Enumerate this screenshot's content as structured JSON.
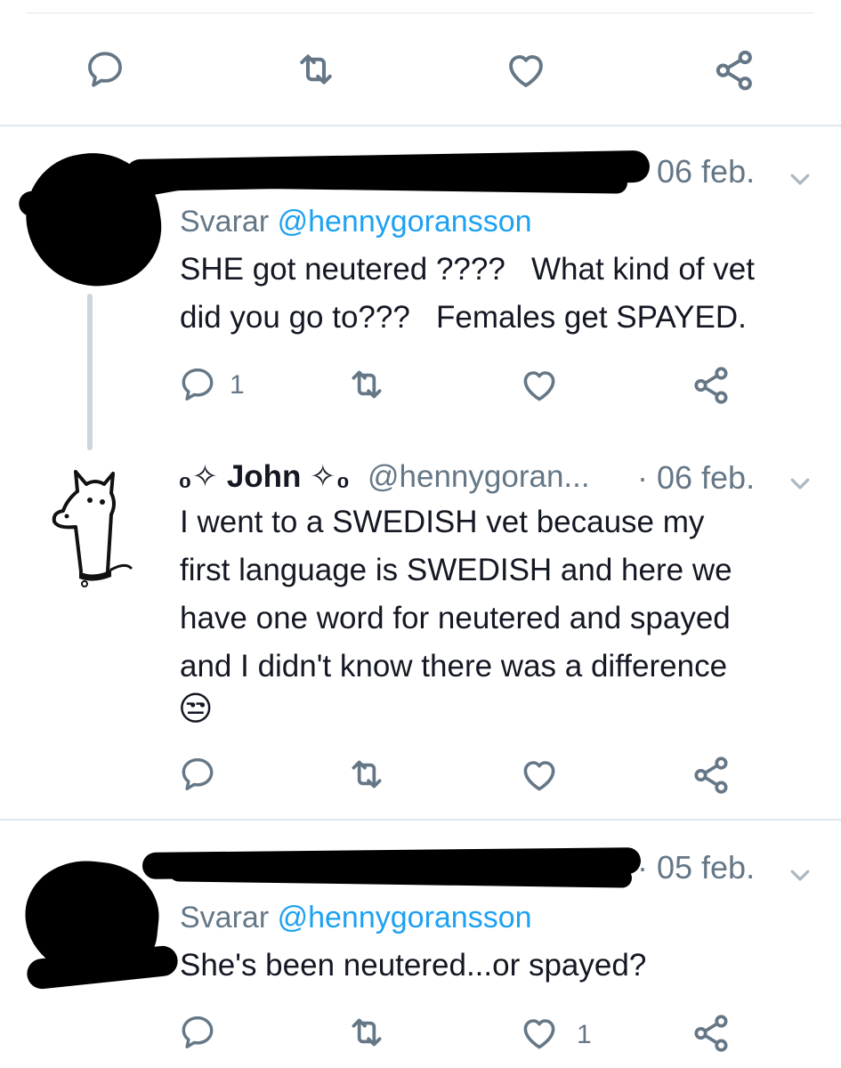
{
  "tweets": [
    {
      "actions": {
        "reply_count": "",
        "like_count": ""
      }
    },
    {
      "date": "06 feb.",
      "replying_prefix": "Svarar",
      "replying_handle": "@hennygoransson",
      "text": "SHE got neutered ????   What kind of vet\ndid you go to???   Females get SPAYED.",
      "actions": {
        "reply_count": "1",
        "like_count": ""
      }
    },
    {
      "display_name": "₀✧ John ✧₀",
      "username": "@hennygoran...",
      "date": "· 06 feb.",
      "text": "I went to a SWEDISH vet because my\nfirst language is SWEDISH and here we\nhave one word for neutered and spayed\nand I didn't know there was a difference",
      "emoji": "😒",
      "actions": {
        "reply_count": "",
        "like_count": ""
      }
    },
    {
      "date": "· 05 feb.",
      "replying_prefix": "Svarar",
      "replying_handle": "@hennygoransson",
      "text": "She's been neutered...or spayed?",
      "actions": {
        "reply_count": "",
        "like_count": "1"
      }
    }
  ],
  "icons": [
    "reply-icon",
    "retweet-icon",
    "like-icon",
    "share-icon",
    "caret-down-icon"
  ],
  "colors": {
    "icon": "#657786",
    "link": "#1da1f2",
    "divider": "#e1e8ed",
    "thread_line": "#ccd6dd"
  }
}
